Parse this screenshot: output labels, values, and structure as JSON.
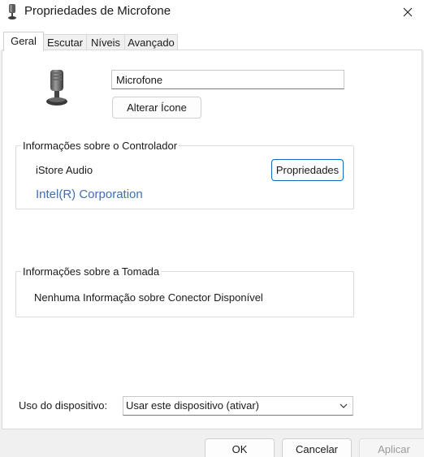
{
  "window": {
    "title": "Propriedades de Microfone",
    "close_icon": "close-icon",
    "app_icon": "microphone-icon"
  },
  "tabs": [
    {
      "label": "Geral",
      "active": true
    },
    {
      "label": "Escutar",
      "active": false
    },
    {
      "label": "Níveis",
      "active": false
    },
    {
      "label": "Avançado",
      "active": false
    }
  ],
  "general": {
    "device_icon": "microphone-icon",
    "device_name_value": "Microfone",
    "change_icon_label": "Alterar Ícone",
    "controller": {
      "legend": "Informações sobre o Controlador",
      "vendor": "iStore Audio",
      "manufacturer": "Intel(R) Corporation",
      "properties_label": "Propriedades"
    },
    "jack": {
      "legend": "Informações sobre a Tomada",
      "info": "Nenhuma Informação sobre Conector Disponível"
    },
    "usage": {
      "label": "Uso do dispositivo:",
      "selected": "Usar este dispositivo (ativar)",
      "dropdown_icon": "chevron-down-icon"
    }
  },
  "footer": {
    "ok_label": "OK",
    "cancel_label": "Cancelar",
    "apply_label": "Aplicar"
  },
  "colors": {
    "link_blue": "#3f6fb0",
    "accent_border": "#0f6cbd"
  }
}
